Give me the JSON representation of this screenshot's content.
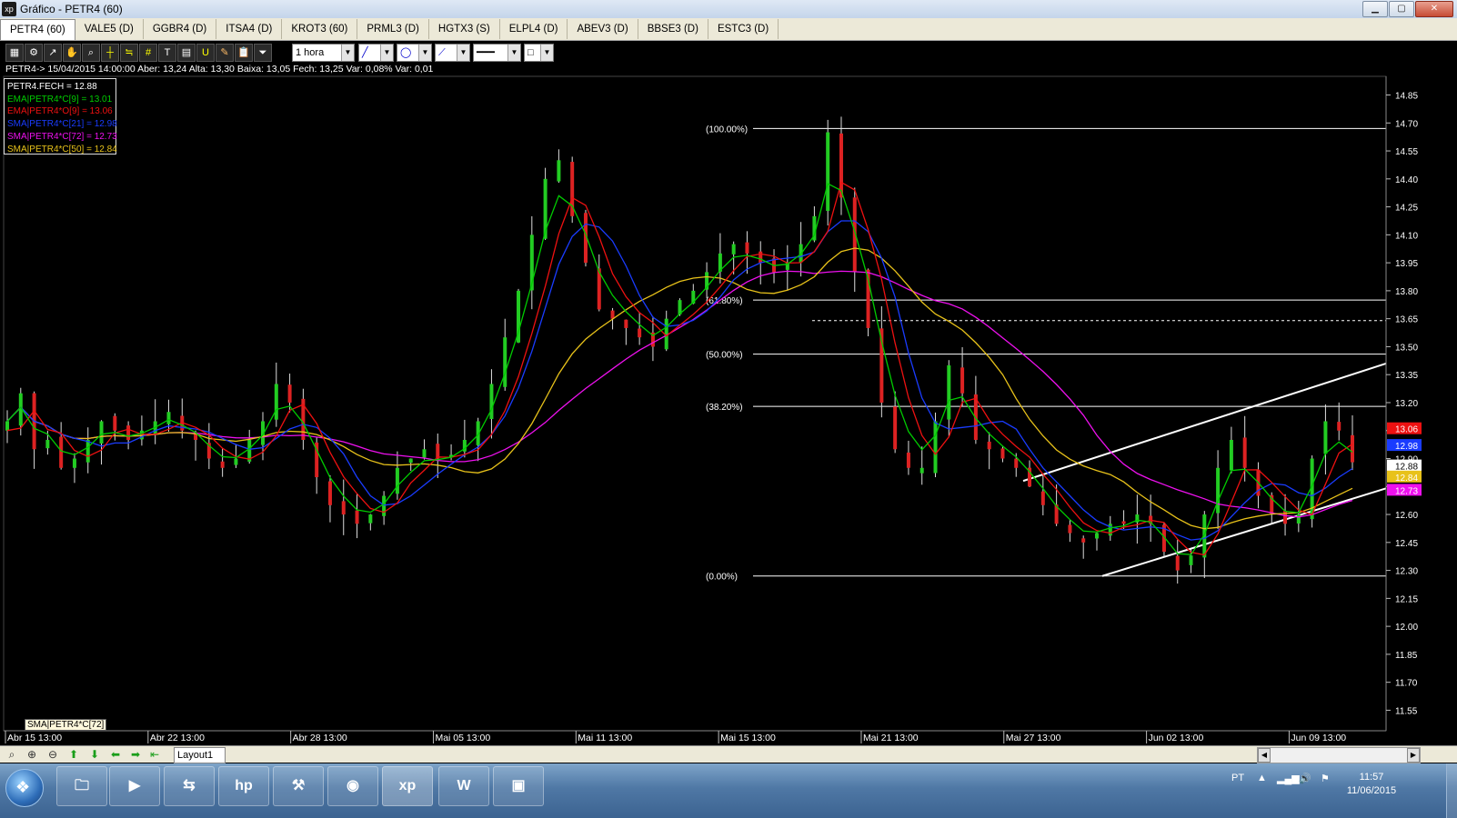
{
  "window": {
    "title": "Gráfico - PETR4 (60)",
    "logo": "xp",
    "minimize": "▁",
    "maximize": "▢",
    "close": "✕"
  },
  "tabs": [
    "PETR4 (60)",
    "VALE5 (D)",
    "GGBR4 (D)",
    "ITSA4 (D)",
    "KROT3 (60)",
    "PRML3 (D)",
    "HGTX3 (S)",
    "ELPL4 (D)",
    "ABEV3 (D)",
    "BBSE3 (D)",
    "ESTC3 (D)"
  ],
  "toolbar": {
    "period": "1 hora"
  },
  "info_line": "PETR4-> 15/04/2015 14:00:00 Aber: 13,24 Alta: 13,30 Baixa: 13,05 Fech: 13,25 Var: 0,08% Var: 0,01",
  "legend": [
    {
      "text": "PETR4.FECH = 12.88",
      "color": "#ffffff"
    },
    {
      "text": "EMA|PETR4*C[9] = 13.01",
      "color": "#00cc00"
    },
    {
      "text": "EMA|PETR4*O[9] = 13.06",
      "color": "#ee1111"
    },
    {
      "text": "SMA|PETR4*C[21] = 12.98",
      "color": "#1a3cff"
    },
    {
      "text": "SMA|PETR4*C[72] = 12.73",
      "color": "#ee11ee"
    },
    {
      "text": "SMA|PETR4*C[50] = 12.84",
      "color": "#e8c21a"
    }
  ],
  "hover_label": "SMA|PETR4*C[72]",
  "layout_tab": "Layout1",
  "taskbar": {
    "language": "PT",
    "time": "11:57",
    "date": "11/06/2015",
    "apps": [
      "windows-explorer",
      "media-player",
      "network",
      "hp",
      "app-tool",
      "chrome",
      "xp",
      "word",
      "image-viewer"
    ]
  },
  "chart_data": {
    "type": "candlestick",
    "symbol": "PETR4",
    "interval": "60",
    "ylim": [
      11.44,
      14.95
    ],
    "y_ticks": [
      "14.85",
      "14.70",
      "14.55",
      "14.40",
      "14.25",
      "14.10",
      "13.95",
      "13.80",
      "13.65",
      "13.50",
      "13.35",
      "13.20",
      "13.05",
      "12.90",
      "12.75",
      "12.60",
      "12.45",
      "12.30",
      "12.15",
      "12.00",
      "11.85",
      "11.70",
      "11.55"
    ],
    "x_labels": [
      "Abr 15 13:00",
      "Abr 22 13:00",
      "Abr 28 13:00",
      "Mai 05 13:00",
      "Mai 11 13:00",
      "Mai 15 13:00",
      "Mai 21 13:00",
      "Mai 27 13:00",
      "Jun 02 13:00",
      "Jun 09 13:00"
    ],
    "price_close": [
      13.1,
      13.25,
      12.95,
      13.0,
      12.85,
      12.9,
      13.0,
      13.1,
      13.05,
      13.0,
      13.05,
      13.1,
      13.15,
      13.05,
      13.0,
      12.9,
      12.85,
      12.9,
      13.0,
      13.1,
      13.3,
      13.2,
      13.0,
      12.8,
      12.65,
      12.6,
      12.55,
      12.6,
      12.7,
      12.85,
      12.9,
      12.95,
      12.9,
      12.92,
      13.0,
      13.1,
      13.3,
      13.55,
      13.8,
      14.1,
      14.4,
      14.5,
      14.2,
      13.95,
      13.7,
      13.65,
      13.6,
      13.55,
      13.5,
      13.65,
      13.75,
      13.8,
      13.9,
      14.0,
      14.05,
      14.0,
      13.95,
      13.9,
      13.95,
      14.05,
      14.2,
      14.65,
      14.3,
      13.9,
      13.6,
      13.2,
      12.95,
      12.85,
      12.85,
      13.1,
      13.4,
      13.25,
      13.0,
      12.95,
      12.9,
      12.85,
      12.75,
      12.65,
      12.55,
      12.5,
      12.45,
      12.5,
      12.55,
      12.55,
      12.6,
      12.55,
      12.4,
      12.3,
      12.38,
      12.6,
      12.85,
      13.0,
      12.85,
      12.7,
      12.6,
      12.55,
      12.6,
      12.9,
      13.1,
      13.05,
      12.88
    ],
    "fibonacci": [
      {
        "label": "(100.00%)",
        "value": 14.67
      },
      {
        "label": "(61.80%)",
        "value": 13.75
      },
      {
        "label": "(50.00%)",
        "value": 13.46
      },
      {
        "label": "(38.20%)",
        "value": 13.18
      },
      {
        "label": "(0.00%)",
        "value": 12.27
      }
    ],
    "dotted_level": 13.64,
    "channel": {
      "upper": [
        [
          12.78,
          13.41
        ]
      ],
      "lower": [
        [
          12.27,
          12.74
        ]
      ]
    },
    "last_values": [
      {
        "value": "13.06",
        "color": "#ee1111"
      },
      {
        "value": "12.98",
        "color": "#1a3cff"
      },
      {
        "value": "12.88",
        "color": "#000000",
        "bg": "#ffffff"
      },
      {
        "value": "12.84",
        "color": "#e8c21a"
      },
      {
        "value": "12.73",
        "color": "#ee11ee"
      }
    ],
    "series": [
      {
        "name": "EMA|PETR4*C[9]",
        "color": "#00cc00"
      },
      {
        "name": "EMA|PETR4*O[9]",
        "color": "#ee1111"
      },
      {
        "name": "SMA|PETR4*C[21]",
        "color": "#1a3cff"
      },
      {
        "name": "SMA|PETR4*C[72]",
        "color": "#ee11ee"
      },
      {
        "name": "SMA|PETR4*C[50]",
        "color": "#e8c21a"
      }
    ]
  }
}
